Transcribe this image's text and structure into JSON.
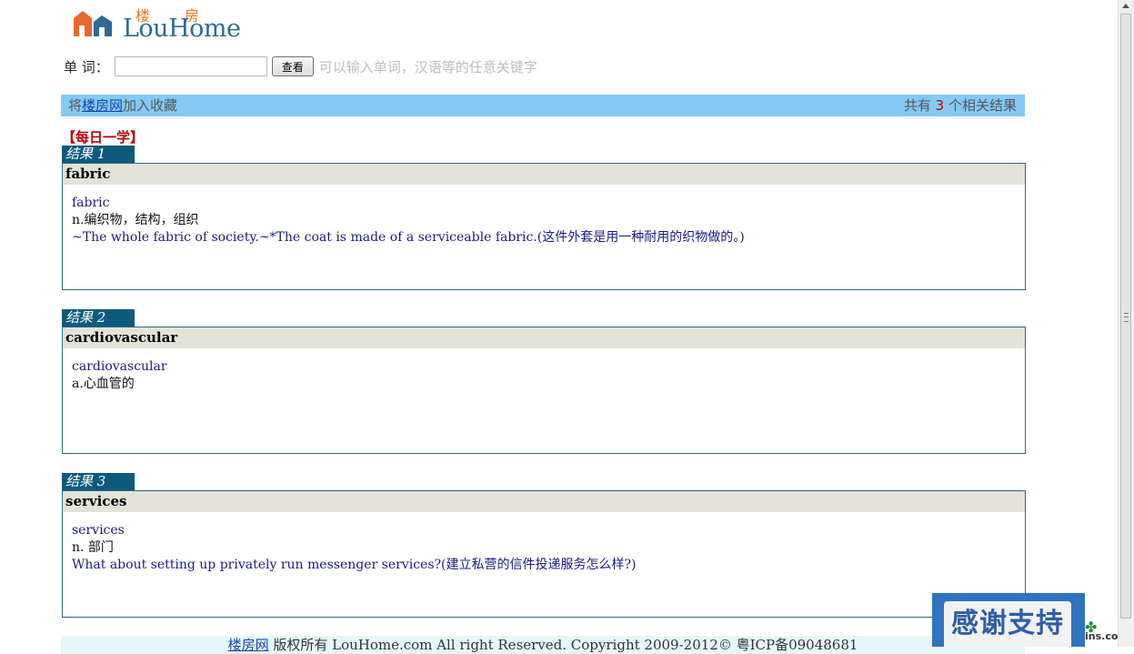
{
  "logo": {
    "cn": "楼房",
    "en": "LouHome"
  },
  "search": {
    "label": "单 词：",
    "value": "",
    "placeholder": "",
    "button": "查看",
    "hint": "可以输入单词，汉语等的任意关键字"
  },
  "info_bar": {
    "left_prefix": "将",
    "site_link": "楼房网",
    "left_suffix": "加入收藏",
    "right_prefix": "共有 ",
    "count": "3",
    "right_suffix": " 个相关结果"
  },
  "daily_title": "【每日一学】",
  "results": [
    {
      "tag": "结果 1",
      "word": "fabric",
      "word_line": "fabric",
      "definition": "n.编织物，结构，组织",
      "example": "~The whole fabric of society.~*The coat is made of a serviceable fabric.(这件外套是用一种耐用的织物做的。)"
    },
    {
      "tag": "结果 2",
      "word": "cardiovascular",
      "word_line": "cardiovascular",
      "definition": "a.心血管的",
      "example": ""
    },
    {
      "tag": "结果 3",
      "word": "services",
      "word_line": "services",
      "definition": "n. 部门",
      "example": "What about setting up privately run messenger services?(建立私营的信件投递服务怎么样?)"
    }
  ],
  "footer": {
    "site_link": "楼房网",
    "text": " 版权所有 LouHome.com All right Reserved. Copyright 2009-2012© 粤ICP备09048681"
  },
  "overlay": {
    "thanks": "感谢支持",
    "watermark": "ins.com"
  },
  "colors": {
    "accent_bar": "#84c9f4",
    "tag_bg": "#0d5a7d",
    "highlight": "#c00000"
  }
}
